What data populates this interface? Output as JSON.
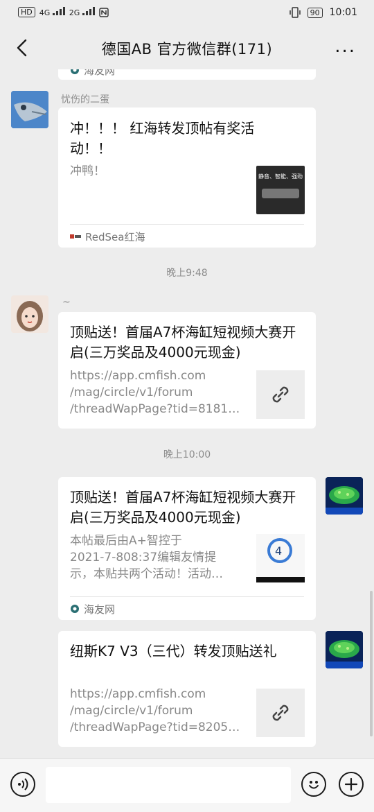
{
  "status": {
    "left_badges": [
      "HD",
      "4G",
      "2G"
    ],
    "battery": "90",
    "time": "10:01"
  },
  "nav": {
    "title": "德国AB  官方微信群(171)",
    "more": "..."
  },
  "messages": [
    {
      "top_footer": "海友网"
    },
    {
      "sender": "忧伤的二蛋",
      "title": "冲！！！ 红海转发顶帖有奖活动！！",
      "desc": "冲鸭！",
      "footer": "RedSea红海",
      "thumb_text": "静音、智能、强劲"
    },
    {
      "time": "晚上9:48"
    },
    {
      "sender": "~",
      "title": "顶贴送！首届A7杯海缸短视频大赛开启(三万奖品及4000元现金)",
      "desc_lines": [
        "https://app.cmfish.com",
        "/mag/circle/v1/forum",
        "/threadWapPage?tid=8181…"
      ]
    },
    {
      "time": "晚上10:00"
    },
    {
      "title": "顶贴送！首届A7杯海缸短视频大赛开启(三万奖品及4000元现金)",
      "desc_lines": [
        "本帖最后由A+智控于",
        "2021-7-808:37编辑友情提",
        "示，本贴共两个活动！活动…"
      ],
      "footer": "海友网"
    },
    {
      "title": "纽斯K7 V3（三代）转发顶贴送礼",
      "desc_lines": [
        "https://app.cmfish.com",
        "/mag/circle/v1/forum",
        "/threadWapPage?tid=8205…"
      ]
    }
  ],
  "colors": {
    "bg": "#ededed",
    "card": "#ffffff",
    "muted": "#8c8c8c"
  },
  "icons": {
    "back": "back-arrow-icon",
    "link": "link-icon",
    "voice": "voice-icon",
    "emoji": "emoji-icon",
    "plus": "plus-icon"
  }
}
